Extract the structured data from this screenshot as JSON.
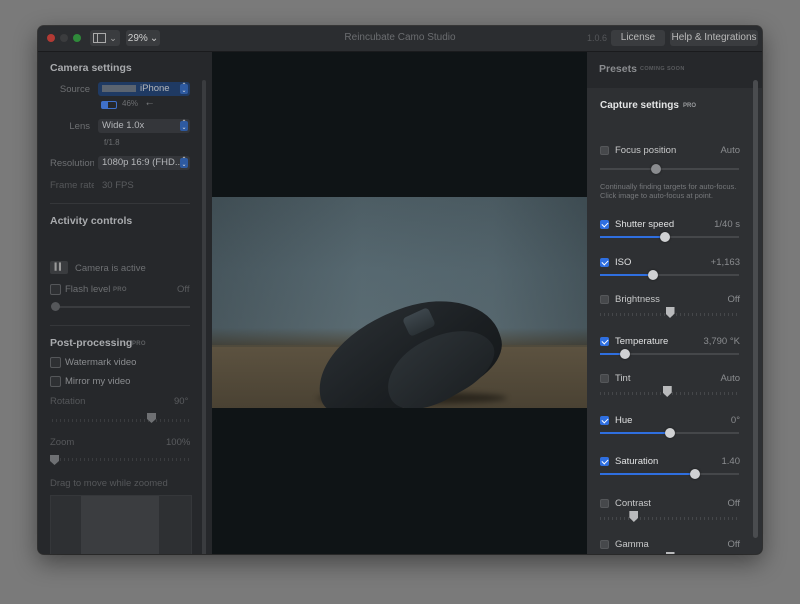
{
  "window": {
    "title": "Reincubate Camo Studio",
    "version": "1.0.6",
    "zoom": "29%",
    "license_label": "License",
    "help_label": "Help & Integrations"
  },
  "camera_settings": {
    "title": "Camera settings",
    "source_label": "Source",
    "source_value": "iPhone",
    "battery": "46%",
    "connection_icon": "usb-icon",
    "lens_label": "Lens",
    "lens_value": "Wide 1.0x",
    "aperture": "f/1.8",
    "resolution_label": "Resolution",
    "resolution_value": "1080p 16:9 (FHD...",
    "framerate_label": "Frame rate",
    "framerate_value": "30 FPS"
  },
  "activity_controls": {
    "title": "Activity controls",
    "camera_status": "Camera is active",
    "flash_label": "Flash level",
    "flash_pro": "PRO",
    "flash_value": "Off"
  },
  "post_processing": {
    "title": "Post-processing",
    "pro": "PRO",
    "watermark_label": "Watermark video",
    "mirror_label": "Mirror my video",
    "rotation_label": "Rotation",
    "rotation_value": "90°",
    "zoom_label": "Zoom",
    "zoom_value": "100%",
    "drag_hint": "Drag to move while zoomed"
  },
  "presets": {
    "title": "Presets",
    "badge": "COMING SOON"
  },
  "capture_settings": {
    "title": "Capture settings",
    "pro": "PRO",
    "focus_note": "Continually finding targets for auto-focus. Click image to auto-focus at point.",
    "items": [
      {
        "label": "Focus position",
        "value": "Auto",
        "checked": false,
        "level": 0.4
      },
      {
        "label": "Shutter speed",
        "value": "1/40 s",
        "checked": true,
        "level": 0.47
      },
      {
        "label": "ISO",
        "value": "+1,163",
        "checked": true,
        "level": 0.38
      },
      {
        "label": "Brightness",
        "value": "Off",
        "checked": false,
        "level": 0.5
      },
      {
        "label": "Temperature",
        "value": "3,790 °K",
        "checked": true,
        "level": 0.18
      },
      {
        "label": "Tint",
        "value": "Auto",
        "checked": false,
        "level": 0.48
      },
      {
        "label": "Hue",
        "value": "0°",
        "checked": true,
        "level": 0.5
      },
      {
        "label": "Saturation",
        "value": "1.40",
        "checked": true,
        "level": 0.68
      },
      {
        "label": "Contrast",
        "value": "Off",
        "checked": false,
        "level": 0.24
      },
      {
        "label": "Gamma",
        "value": "Off",
        "checked": false,
        "level": 0.5
      }
    ]
  }
}
